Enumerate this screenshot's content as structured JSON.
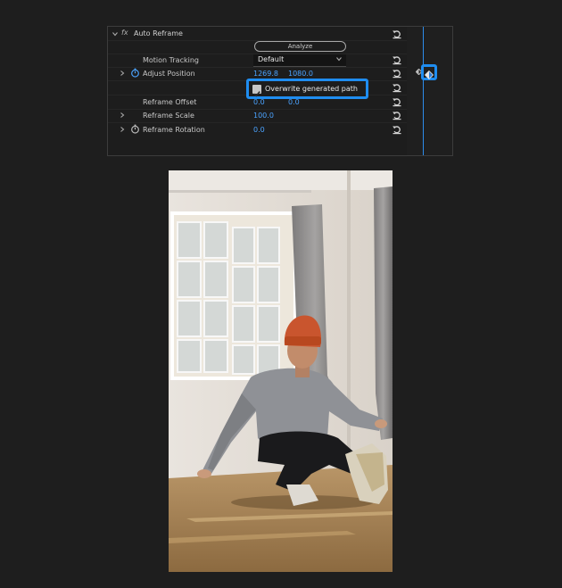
{
  "effect": {
    "fx_label": "fx",
    "name": "Auto Reframe",
    "analyze_label": "Analyze",
    "motion_tracking": {
      "label": "Motion Tracking",
      "value": "Default"
    },
    "adjust_position": {
      "label": "Adjust Position",
      "x": "1269.8",
      "y": "1080.0"
    },
    "overwrite": {
      "label": "Overwrite generated path",
      "checked": true
    },
    "reframe_offset": {
      "label": "Reframe Offset",
      "x": "0.0",
      "y": "0.0"
    },
    "reframe_scale": {
      "label": "Reframe Scale",
      "value": "100.0"
    },
    "reframe_rotation": {
      "label": "Reframe Rotation",
      "value": "0.0"
    }
  },
  "colors": {
    "accent": "#1f8df0",
    "value_blue": "#4ba3ff",
    "panel_bg": "#1d1d1d",
    "page_bg": "#1e1e1e"
  },
  "icons": {
    "collapse": "chevron-down-icon",
    "expand": "chevron-right-icon",
    "reset": "reset-parameter-icon",
    "stopwatch": "stopwatch-icon",
    "keyframe": "keyframe-diamond-icon"
  }
}
